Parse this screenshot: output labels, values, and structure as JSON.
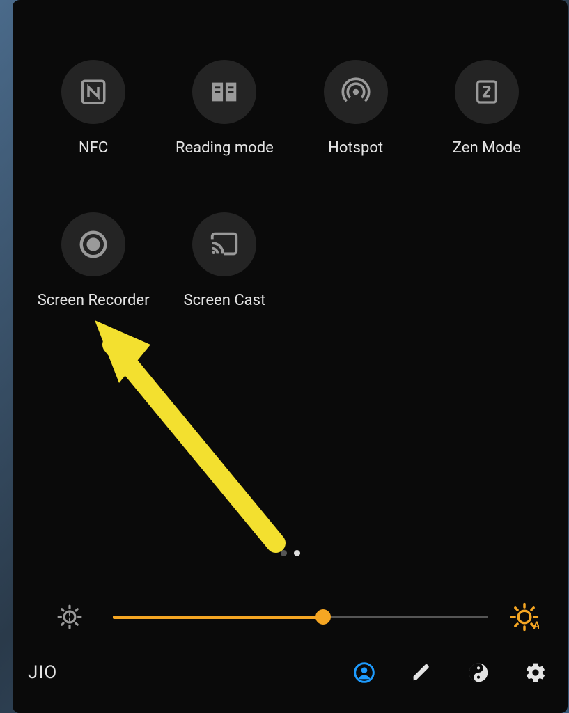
{
  "tiles": [
    {
      "label": "NFC",
      "icon": "nfc"
    },
    {
      "label": "Reading mode",
      "icon": "reading"
    },
    {
      "label": "Hotspot",
      "icon": "hotspot"
    },
    {
      "label": "Zen Mode",
      "icon": "zen"
    },
    {
      "label": "Screen Recorder",
      "icon": "recorder"
    },
    {
      "label": "Screen Cast",
      "icon": "cast"
    }
  ],
  "page_dots": {
    "count": 2,
    "active": 1
  },
  "brightness": {
    "percent": 56,
    "auto_brightness_active": true
  },
  "carrier": "JIO",
  "bottom_icons": [
    "user",
    "edit",
    "yin-yang",
    "settings"
  ],
  "annotation_color": "#f3e02f"
}
